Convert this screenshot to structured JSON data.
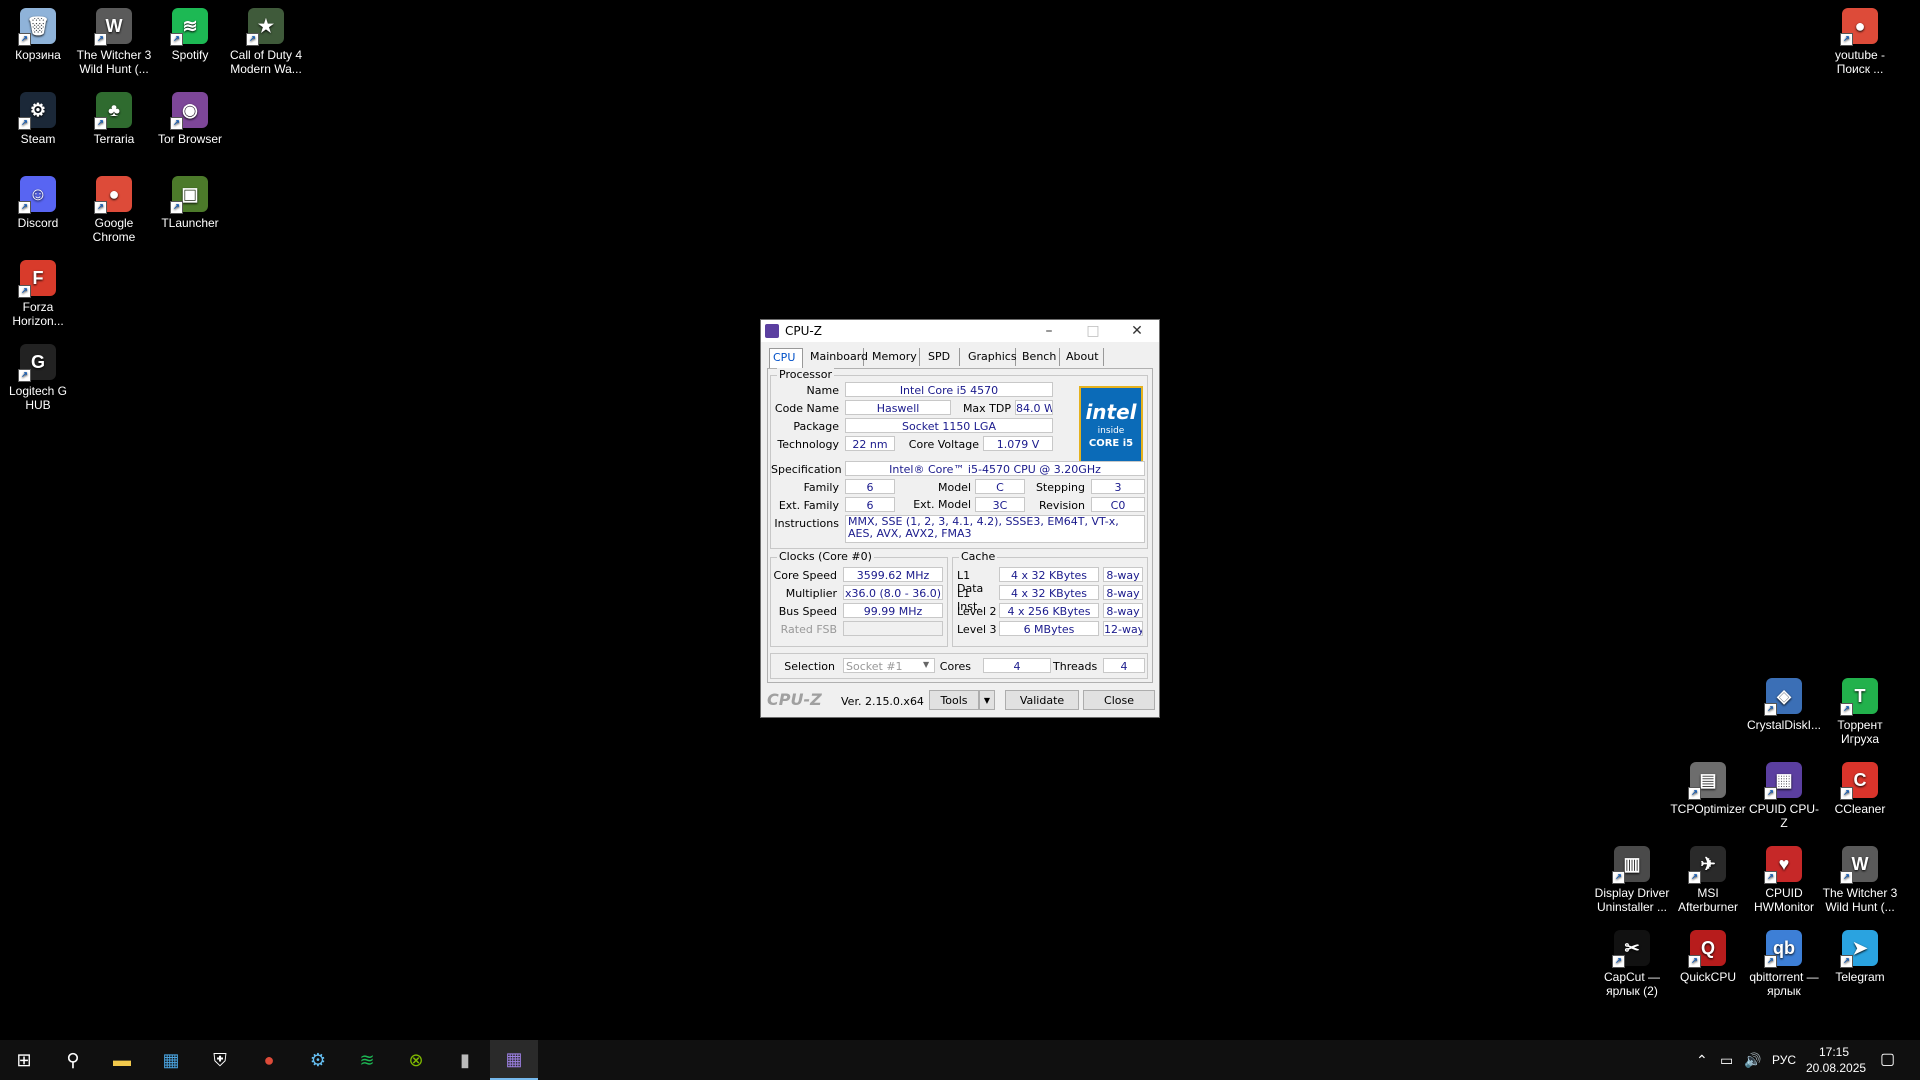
{
  "desktop": {
    "left_icons": [
      {
        "label": "Корзина",
        "icon": "recycle-bin-icon",
        "color": "#8fb3d9",
        "glyph": "🗑"
      },
      {
        "label": "The Witcher 3 Wild Hunt (...",
        "icon": "witcher-icon",
        "color": "#5a5a5a",
        "glyph": "W"
      },
      {
        "label": "Spotify",
        "icon": "spotify-icon",
        "color": "#1db954",
        "glyph": "≋"
      },
      {
        "label": "Call of Duty 4 Modern Wa...",
        "icon": "cod4-icon",
        "color": "#3f5a3a",
        "glyph": "★"
      },
      {
        "label": "Steam",
        "icon": "steam-icon",
        "color": "#1b2838",
        "glyph": "⚙"
      },
      {
        "label": "Terraria",
        "icon": "terraria-icon",
        "color": "#2f6b2f",
        "glyph": "♣"
      },
      {
        "label": "Tor Browser",
        "icon": "tor-browser-icon",
        "color": "#7d4698",
        "glyph": "◉"
      },
      {
        "label": "Discord",
        "icon": "discord-icon",
        "color": "#5865f2",
        "glyph": "☺"
      },
      {
        "label": "Google Chrome",
        "icon": "chrome-icon",
        "color": "#dd4b39",
        "glyph": "●"
      },
      {
        "label": "TLauncher",
        "icon": "tlauncher-icon",
        "color": "#4c7a2a",
        "glyph": "▣"
      },
      {
        "label": "Forza Horizon...",
        "icon": "forza-icon",
        "color": "#d83b2b",
        "glyph": "F"
      },
      {
        "label": "Logitech G HUB",
        "icon": "logitech-icon",
        "color": "#222222",
        "glyph": "G"
      }
    ],
    "right_top_icon": {
      "label": "youtube - Поиск ...",
      "icon": "chrome-shortcut-icon",
      "color": "#dd4b39",
      "glyph": "●"
    },
    "right_icons": [
      {
        "label": "CrystalDiskI...",
        "icon": "crystaldisk-icon",
        "color": "#3b6fb6",
        "glyph": "◈"
      },
      {
        "label": "Торрент Игруха",
        "icon": "torrent-igruha-icon",
        "color": "#22b14c",
        "glyph": "T"
      },
      {
        "label": "TCPOptimizer",
        "icon": "tcpoptimizer-icon",
        "color": "#6d6d6d",
        "glyph": "▤"
      },
      {
        "label": "CPUID CPU-Z",
        "icon": "cpuz-icon",
        "color": "#5b3fa0",
        "glyph": "▦"
      },
      {
        "label": "CCleaner",
        "icon": "ccleaner-icon",
        "color": "#d9342b",
        "glyph": "C"
      },
      {
        "label": "Display Driver Uninstaller ...",
        "icon": "ddu-icon",
        "color": "#4a4a4a",
        "glyph": "▥"
      },
      {
        "label": "MSI Afterburner",
        "icon": "afterburner-icon",
        "color": "#2a2a2a",
        "glyph": "✈"
      },
      {
        "label": "CPUID HWMonitor",
        "icon": "hwmonitor-icon",
        "color": "#c62828",
        "glyph": "♥"
      },
      {
        "label": "The Witcher 3 Wild Hunt (...",
        "icon": "witcher-icon",
        "color": "#5a5a5a",
        "glyph": "W"
      },
      {
        "label": "CapCut — ярлык (2)",
        "icon": "capcut-icon",
        "color": "#111111",
        "glyph": "✂"
      },
      {
        "label": "QuickCPU",
        "icon": "quickcpu-icon",
        "color": "#b71c1c",
        "glyph": "Q"
      },
      {
        "label": "qbittorrent — ярлык",
        "icon": "qbittorrent-icon",
        "color": "#3d7fd6",
        "glyph": "qb"
      },
      {
        "label": "Telegram",
        "icon": "telegram-icon",
        "color": "#2aa3e0",
        "glyph": "➤"
      }
    ]
  },
  "cpuz": {
    "title": "CPU-Z",
    "tabs": [
      "CPU",
      "Mainboard",
      "Memory",
      "SPD",
      "Graphics",
      "Bench",
      "About"
    ],
    "processor": {
      "group_title": "Processor",
      "name_label": "Name",
      "name": "Intel Core i5 4570",
      "codename_label": "Code Name",
      "codename": "Haswell",
      "maxtdp_label": "Max TDP",
      "maxtdp": "84.0 W",
      "package_label": "Package",
      "package": "Socket 1150 LGA",
      "technology_label": "Technology",
      "technology": "22 nm",
      "corevoltage_label": "Core Voltage",
      "corevoltage": "1.079 V",
      "spec_label": "Specification",
      "spec": "Intel® Core™ i5-4570 CPU @ 3.20GHz",
      "family_label": "Family",
      "family": "6",
      "model_label": "Model",
      "model": "C",
      "stepping_label": "Stepping",
      "stepping": "3",
      "extfamily_label": "Ext. Family",
      "extfamily": "6",
      "extmodel_label": "Ext. Model",
      "extmodel": "3C",
      "revision_label": "Revision",
      "revision": "C0",
      "instructions_label": "Instructions",
      "instructions": "MMX, SSE (1, 2, 3, 4.1, 4.2), SSSE3, EM64T, VT-x, AES, AVX, AVX2, FMA3"
    },
    "logo": {
      "brand": "intel",
      "line1": "inside",
      "line2": "CORE i5"
    },
    "clocks": {
      "group_title": "Clocks (Core #0)",
      "corespeed_label": "Core Speed",
      "corespeed": "3599.62 MHz",
      "multiplier_label": "Multiplier",
      "multiplier": "x36.0 (8.0 - 36.0)",
      "busspeed_label": "Bus Speed",
      "busspeed": "99.99 MHz",
      "ratedfsb_label": "Rated FSB",
      "ratedfsb": ""
    },
    "cache": {
      "group_title": "Cache",
      "rows": [
        {
          "label": "L1 Data",
          "size": "4 x 32 KBytes",
          "way": "8-way"
        },
        {
          "label": "L1 Inst.",
          "size": "4 x 32 KBytes",
          "way": "8-way"
        },
        {
          "label": "Level 2",
          "size": "4 x 256 KBytes",
          "way": "8-way"
        },
        {
          "label": "Level 3",
          "size": "6 MBytes",
          "way": "12-way"
        }
      ]
    },
    "selection": {
      "label": "Selection",
      "value": "Socket #1",
      "cores_label": "Cores",
      "cores": "4",
      "threads_label": "Threads",
      "threads": "4"
    },
    "footer": {
      "brand": "CPU-Z",
      "version": "Ver. 2.15.0.x64",
      "tools": "Tools",
      "validate": "Validate",
      "close": "Close"
    }
  },
  "taskbar": {
    "apps": [
      {
        "name": "start-button",
        "glyph": "⊞"
      },
      {
        "name": "search-button",
        "glyph": "⚲"
      },
      {
        "name": "file-explorer",
        "glyph": "▬"
      },
      {
        "name": "calculator-app",
        "glyph": "▦"
      },
      {
        "name": "security-app",
        "glyph": "⛨"
      },
      {
        "name": "chrome-app",
        "glyph": "●"
      },
      {
        "name": "steam-app",
        "glyph": "⚙"
      },
      {
        "name": "spotify-app",
        "glyph": "≋"
      },
      {
        "name": "xbox-app",
        "glyph": "⊗"
      },
      {
        "name": "usb-app",
        "glyph": "▮"
      },
      {
        "name": "cpuz-app",
        "glyph": "▦"
      }
    ],
    "lang": "РУС",
    "time": "17:15",
    "date": "20.08.2025"
  }
}
